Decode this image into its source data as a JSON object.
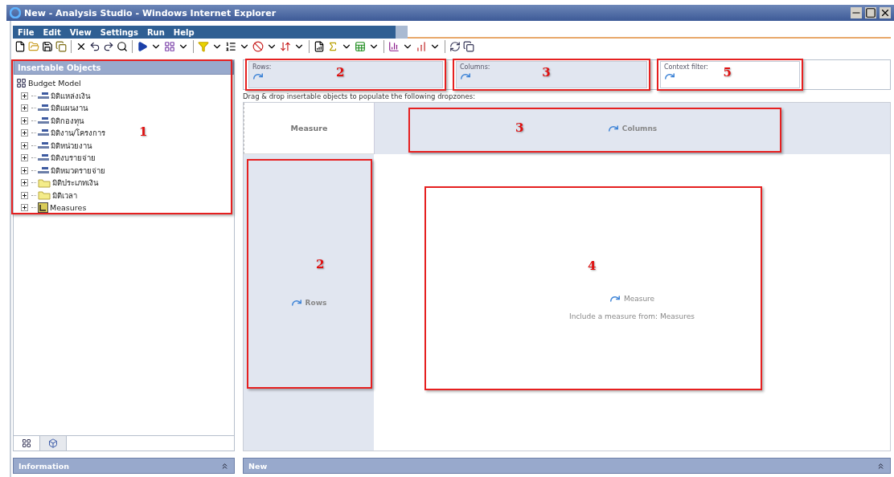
{
  "window": {
    "title": "New - Analysis Studio - Windows Internet Explorer"
  },
  "menu": [
    "File",
    "Edit",
    "View",
    "Settings",
    "Run",
    "Help"
  ],
  "left_panel": {
    "title": "Insertable Objects",
    "annotation": "1",
    "tree": {
      "label": "Budget Model",
      "kind": "model",
      "children": [
        {
          "label": "มิติแหล่งเงิน",
          "kind": "dimension",
          "expanded": false
        },
        {
          "label": "มิติแผนงาน",
          "kind": "dimension",
          "expanded": false
        },
        {
          "label": "มิติกองทุน",
          "kind": "dimension",
          "expanded": false
        },
        {
          "label": "มิติงาน/โครงการ",
          "kind": "dimension",
          "expanded": false
        },
        {
          "label": "มิติหน่วยงาน",
          "kind": "dimension",
          "expanded": false
        },
        {
          "label": "มิติงบรายจ่าย",
          "kind": "dimension",
          "expanded": false
        },
        {
          "label": "มิติหมวดรายจ่าย",
          "kind": "dimension",
          "expanded": false
        },
        {
          "label": "มิติประเภทเงิน",
          "kind": "folder",
          "expanded": false
        },
        {
          "label": "มิติเวลา",
          "kind": "folder",
          "expanded": false
        },
        {
          "label": "Measures",
          "kind": "measures",
          "expanded": false
        }
      ]
    },
    "tabs": [
      {
        "kind": "tree",
        "selected": true
      },
      {
        "kind": "cube",
        "selected": false
      }
    ],
    "footer": "Information"
  },
  "dropzones": [
    {
      "label": "Rows:",
      "annotation": "2"
    },
    {
      "label": "Columns:",
      "annotation": "3"
    },
    {
      "label": "Context filter:",
      "annotation": "5"
    }
  ],
  "instruction": "Drag & drop insertable objects to populate the following dropzones:",
  "crosstab": {
    "corner": "Measure",
    "columns": {
      "label": "Columns",
      "annotation": "3"
    },
    "rows": {
      "label": "Rows",
      "annotation": "2"
    },
    "body": {
      "label": "Measure",
      "hint": "Include a measure from: Measures",
      "annotation": "4"
    }
  },
  "bottom_panel": "New"
}
